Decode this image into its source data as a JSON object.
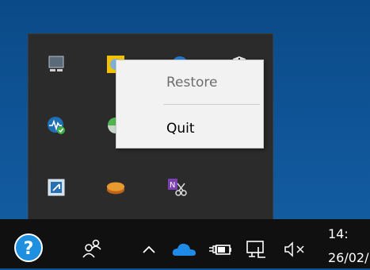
{
  "context_menu": {
    "items": [
      {
        "label": "Restore",
        "enabled": false
      },
      {
        "label": "Quit",
        "enabled": true
      }
    ]
  },
  "taskbar": {
    "clock_time": "14:",
    "clock_date": "26/02/"
  },
  "tray_icons": [
    "network-computer-icon",
    "app-yellow-icon",
    "bluetooth-icon",
    "shield-icon",
    "network-monitor-icon",
    "green-sphere-icon",
    "remote-app-icon",
    "orange-disk-icon",
    "onenote-clipper-icon"
  ],
  "colors": {
    "desktop": "#0b4a88",
    "taskbar": "#101010",
    "tray_panel": "#2b2b2b",
    "menu_background": "#f2f2f2",
    "onedrive_blue": "#1e8ce6"
  }
}
